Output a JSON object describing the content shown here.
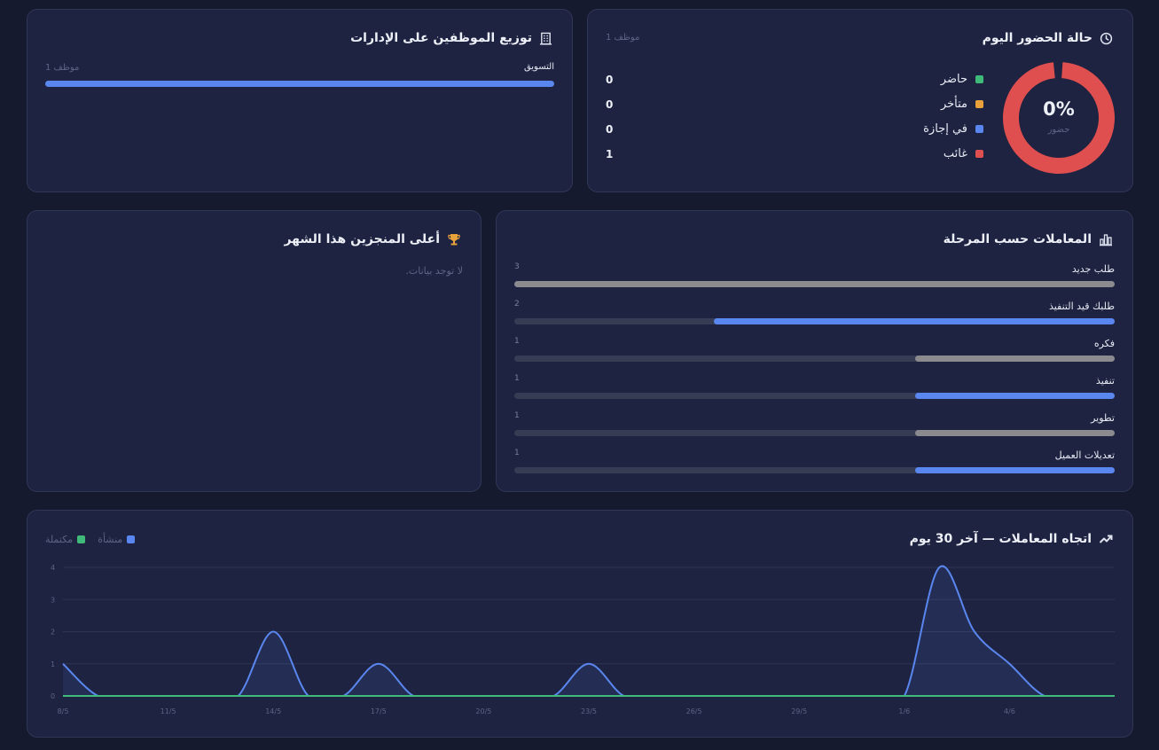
{
  "attendance": {
    "title": "حالة الحضور اليوم",
    "employee_count": "1 موظف",
    "percent": "0%",
    "percent_label": "حضور",
    "items": [
      {
        "label": "حاضر",
        "value": "0",
        "color": "#3fba78"
      },
      {
        "label": "متأخر",
        "value": "0",
        "color": "#e9a23b"
      },
      {
        "label": "في إجازة",
        "value": "0",
        "color": "#5a86ef"
      },
      {
        "label": "غائب",
        "value": "1",
        "color": "#e04f4f"
      }
    ],
    "ring_color": "#e04f4f"
  },
  "departments": {
    "title": "توزيع الموظفين على الإدارات",
    "items": [
      {
        "label": "التسويق",
        "count": "1 موظف",
        "fraction": 1.0
      }
    ]
  },
  "stages": {
    "title": "المعاملات حسب المرحلة",
    "items": [
      {
        "label": "طلب جديد",
        "value": "3",
        "fraction": 1.0,
        "color": "#8a8a8f"
      },
      {
        "label": "طلبك قيد التنفيذ",
        "value": "2",
        "fraction": 0.667,
        "color": "#5a86ef"
      },
      {
        "label": "فكره",
        "value": "1",
        "fraction": 0.333,
        "color": "#8a8a8f"
      },
      {
        "label": "تنفيذ",
        "value": "1",
        "fraction": 0.333,
        "color": "#5a86ef"
      },
      {
        "label": "تطوير",
        "value": "1",
        "fraction": 0.333,
        "color": "#8a8a8f"
      },
      {
        "label": "تعديلات العميل",
        "value": "1",
        "fraction": 0.333,
        "color": "#5a86ef"
      }
    ]
  },
  "top_performers": {
    "title": "أعلى المنجزين هذا الشهر",
    "empty_text": "لا توجد بيانات."
  },
  "trend": {
    "title": "اتجاه المعاملات — آخر 30 يوم",
    "legend": [
      {
        "label": "منشأة",
        "color": "#5a86ef"
      },
      {
        "label": "مكتملة",
        "color": "#3fba78"
      }
    ]
  },
  "chart_data": {
    "type": "line",
    "x": [
      "8/5",
      "9/5",
      "10/5",
      "11/5",
      "12/5",
      "13/5",
      "14/5",
      "15/5",
      "16/5",
      "17/5",
      "18/5",
      "19/5",
      "20/5",
      "21/5",
      "22/5",
      "23/5",
      "24/5",
      "25/5",
      "26/5",
      "27/5",
      "28/5",
      "29/5",
      "30/5",
      "31/5",
      "1/6",
      "2/6",
      "3/6",
      "4/6",
      "5/6",
      "6/6",
      "7/6"
    ],
    "tick_labels": [
      "8/5",
      "11/5",
      "14/5",
      "17/5",
      "20/5",
      "23/5",
      "26/5",
      "29/5",
      "1/6",
      "4/6"
    ],
    "series": [
      {
        "name": "منشأة",
        "color": "#5a86ef",
        "values": [
          1,
          0,
          0,
          0,
          0,
          0,
          2,
          0,
          0,
          1,
          0,
          0,
          0,
          0,
          0,
          1,
          0,
          0,
          0,
          0,
          0,
          0,
          0,
          0,
          0,
          4,
          2,
          1,
          0,
          0,
          0
        ]
      },
      {
        "name": "مكتملة",
        "color": "#3fba78",
        "values": [
          0,
          0,
          0,
          0,
          0,
          0,
          0,
          0,
          0,
          0,
          0,
          0,
          0,
          0,
          0,
          0,
          0,
          0,
          0,
          0,
          0,
          0,
          0,
          0,
          0,
          0,
          0,
          0,
          0,
          0,
          0
        ]
      }
    ],
    "ylim": [
      0,
      4
    ],
    "yticks": [
      "0",
      "1",
      "2",
      "3",
      "4"
    ],
    "grid": true,
    "legend_position": "top-left"
  }
}
